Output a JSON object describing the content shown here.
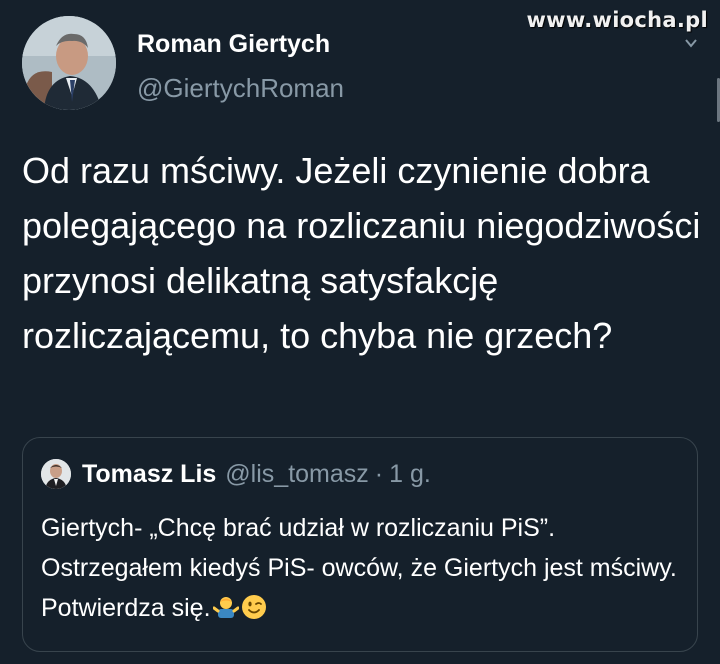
{
  "watermark": "www.wiocha.pl",
  "tweet": {
    "author_name": "Roman Giertych",
    "author_handle": "@GiertychRoman",
    "text": "Od razu mściwy. Jeżeli czynienie dobra polegającego na rozliczaniu niegodziwości przynosi delikatną satysfakcję rozliczającemu, to chyba nie grzech?"
  },
  "quoted_tweet": {
    "author_name": "Tomasz Lis",
    "author_handle": "@lis_tomasz",
    "separator": "·",
    "time": "1 g.",
    "text": "Giertych- „Chcę brać udział w rozliczaniu PiS”. Ostrzegałem kiedyś PiS- owców, że Giertych jest  mściwy. Potwierdza się.",
    "emojis": [
      "person-shrugging-emoji",
      "winking-face-emoji"
    ]
  },
  "icons": {
    "menu": "chevron-down-icon"
  }
}
